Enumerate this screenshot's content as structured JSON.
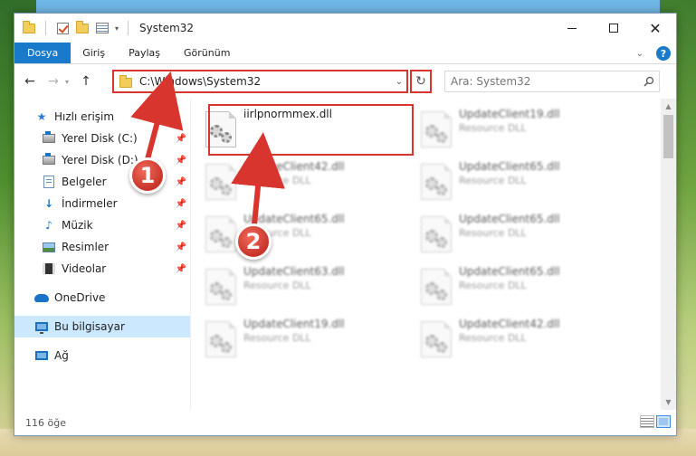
{
  "window": {
    "title": "System32",
    "minimize_label": "",
    "maximize_label": "",
    "close_label": "✕"
  },
  "ribbon": {
    "tabs": [
      {
        "label": "Dosya"
      },
      {
        "label": "Giriş"
      },
      {
        "label": "Paylaş"
      },
      {
        "label": "Görünüm"
      }
    ],
    "help_label": "?"
  },
  "address": {
    "path": "C:\\Windows\\System32",
    "search_placeholder": "Ara: System32"
  },
  "navpane": {
    "quick_access": "Hızlı erişim",
    "items": [
      {
        "label": "Yerel Disk (C:)"
      },
      {
        "label": "Yerel Disk (D:)"
      },
      {
        "label": "Belgeler"
      },
      {
        "label": "İndirmeler"
      },
      {
        "label": "Müzik"
      },
      {
        "label": "Resimler"
      },
      {
        "label": "Videolar"
      }
    ],
    "onedrive": "OneDrive",
    "this_pc": "Bu bilgisayar",
    "network": "Ağ"
  },
  "files": [
    {
      "name": "iirlpnormmex.dll",
      "type": ""
    },
    {
      "name": "UpdateClient19.dll",
      "type": "Resource DLL"
    },
    {
      "name": "UpdateClient42.dll",
      "type": "Resource DLL"
    },
    {
      "name": "UpdateClient65.dll",
      "type": "Resource DLL"
    },
    {
      "name": "UpdateClient65.dll",
      "type": "Resource DLL"
    },
    {
      "name": "UpdateClient65.dll",
      "type": "Resource DLL"
    },
    {
      "name": "UpdateClient63.dll",
      "type": "Resource DLL"
    },
    {
      "name": "UpdateClient65.dll",
      "type": "Resource DLL"
    },
    {
      "name": "UpdateClient19.dll",
      "type": "Resource DLL"
    },
    {
      "name": "UpdateClient42.dll",
      "type": "Resource DLL"
    }
  ],
  "status": {
    "item_count": "116 öğe"
  },
  "annotations": {
    "badge1": "1",
    "badge2": "2",
    "color": "#d9352f"
  },
  "colors": {
    "accent": "#1979ca",
    "selection": "#cce8ff",
    "highlight_border": "#d9352f"
  }
}
